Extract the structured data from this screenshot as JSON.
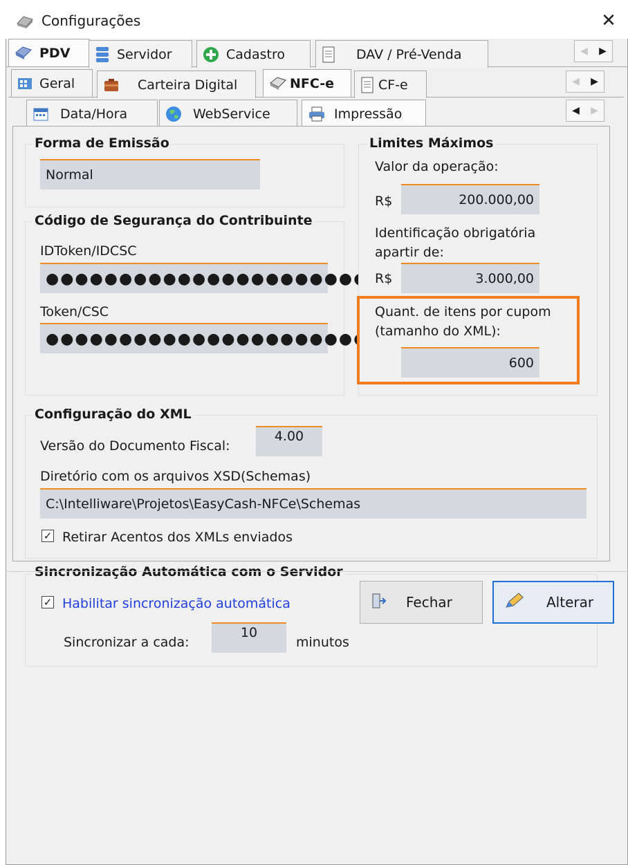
{
  "window": {
    "title": "Configurações",
    "close_label": "✕"
  },
  "tabs_level1": [
    "PDV",
    "Servidor",
    "Cadastro",
    "DAV / Pré-Venda"
  ],
  "tabs_level2": [
    "Geral",
    "Carteira Digital",
    "NFC-e",
    "CF-e"
  ],
  "tabs_level3": [
    "Data/Hora",
    "WebService",
    "Impressão"
  ],
  "forma_emissao": {
    "title": "Forma de Emissão",
    "value": "Normal"
  },
  "limites": {
    "title": "Limites Máximos",
    "valor_label": "Valor da operação:",
    "currency": "R$",
    "valor_value": "200.000,00",
    "ident_label_1": "Identificação obrigatória",
    "ident_label_2": "apartir de:",
    "ident_value": "3.000,00",
    "itens_label_1": "Quant. de itens por cupom",
    "itens_label_2": "(tamanho do XML):",
    "itens_value": "600"
  },
  "csc": {
    "title": "Código de Segurança do Contribuinte",
    "idtoken_label": "IDToken/IDCSC",
    "idtoken_value": "●●●●●●●●●●●●●●●●●●●●●●●●●●",
    "token_label": "Token/CSC",
    "token_value": "●●●●●●●●●●●●●●●●●●●●●●●●●●●●●●●"
  },
  "xml": {
    "title": "Configuração do XML",
    "versao_label": "Versão do Documento Fiscal:",
    "versao_value": "4.00",
    "diretorio_label": "Diretório com os arquivos XSD(Schemas)",
    "diretorio_value": "C:\\Intelliware\\Projetos\\EasyCash-NFCe\\Schemas",
    "acentos_label": "Retirar Acentos dos XMLs enviados",
    "acentos_checked": true
  },
  "sync": {
    "title": "Sincronização Automática com o Servidor",
    "habilitar_label": "Habilitar sincronização automática",
    "habilitar_checked": true,
    "cada_label": "Sincronizar a cada:",
    "cada_value": "10",
    "unit_label": "minutos"
  },
  "buttons": {
    "fechar": "Fechar",
    "alterar": "Alterar"
  },
  "colors": {
    "accent": "#f07c21",
    "field_bg": "#d3d9df",
    "link_blue": "#1f3fe0",
    "focus_blue": "#1c6fd6"
  }
}
